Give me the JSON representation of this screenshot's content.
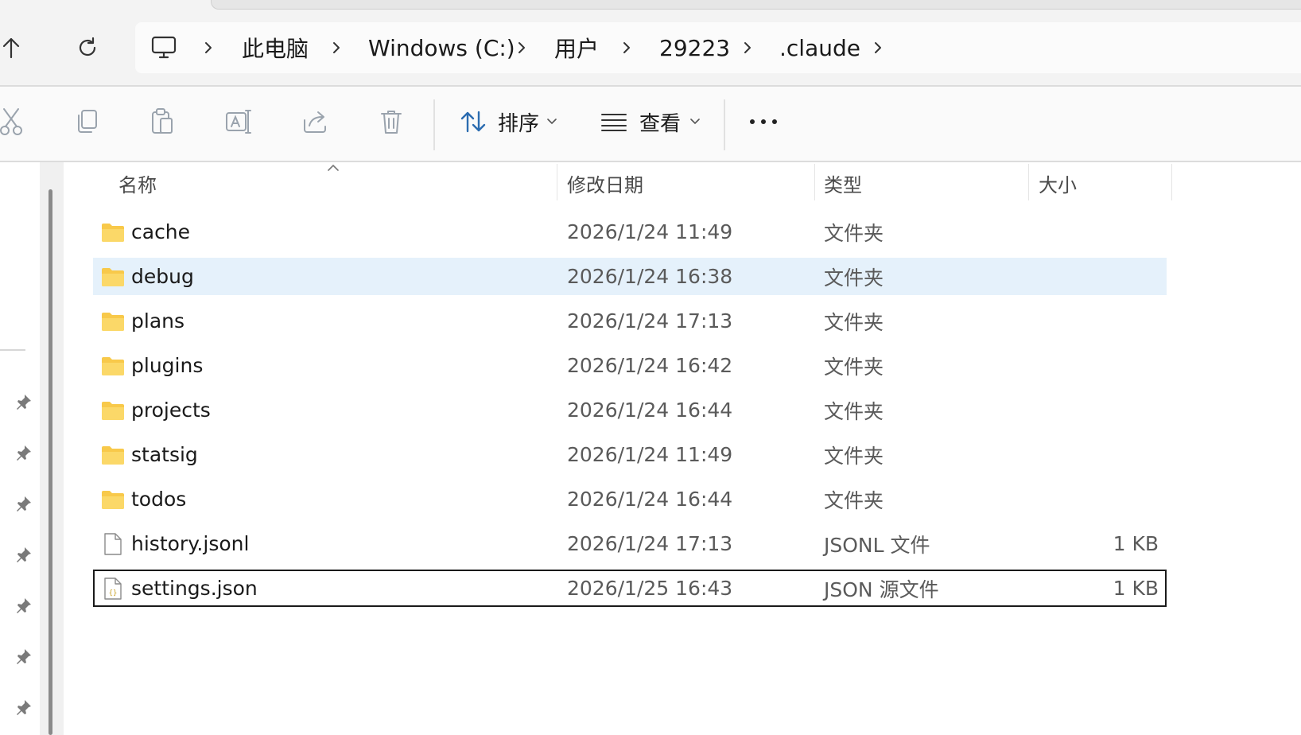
{
  "address_bar": {
    "breadcrumbs": [
      {
        "label": "此电脑"
      },
      {
        "label": "Windows (C:)"
      },
      {
        "label": "用户"
      },
      {
        "label": "29223"
      },
      {
        "label": ".claude"
      }
    ]
  },
  "toolbar": {
    "actions": [
      {
        "icon": "cut-icon"
      },
      {
        "icon": "copy-icon"
      },
      {
        "icon": "paste-icon"
      },
      {
        "icon": "rename-icon"
      },
      {
        "icon": "share-icon"
      },
      {
        "icon": "delete-icon"
      }
    ],
    "sort_label": "排序",
    "view_label": "查看",
    "more_icon": "more-icon"
  },
  "columns": {
    "name": "名称",
    "date": "修改日期",
    "type": "类型",
    "size": "大小"
  },
  "files": [
    {
      "name": "cache",
      "date": "2026/1/24 11:49",
      "type": "文件夹",
      "size": "",
      "kind": "folder"
    },
    {
      "name": "debug",
      "date": "2026/1/24 16:38",
      "type": "文件夹",
      "size": "",
      "kind": "folder",
      "state": "selected"
    },
    {
      "name": "plans",
      "date": "2026/1/24 17:13",
      "type": "文件夹",
      "size": "",
      "kind": "folder"
    },
    {
      "name": "plugins",
      "date": "2026/1/24 16:42",
      "type": "文件夹",
      "size": "",
      "kind": "folder"
    },
    {
      "name": "projects",
      "date": "2026/1/24 16:44",
      "type": "文件夹",
      "size": "",
      "kind": "folder"
    },
    {
      "name": "statsig",
      "date": "2026/1/24 11:49",
      "type": "文件夹",
      "size": "",
      "kind": "folder"
    },
    {
      "name": "todos",
      "date": "2026/1/24 16:44",
      "type": "文件夹",
      "size": "",
      "kind": "folder"
    },
    {
      "name": "history.jsonl",
      "date": "2026/1/24 17:13",
      "type": "JSONL 文件",
      "size": "1 KB",
      "kind": "file"
    },
    {
      "name": "settings.json",
      "date": "2026/1/25 16:43",
      "type": "JSON 源文件",
      "size": "1 KB",
      "kind": "json",
      "state": "focused"
    }
  ],
  "colors": {
    "selection": "#e5f1fb",
    "folder": "#f8c94a",
    "accent": "#2b6cb0"
  }
}
